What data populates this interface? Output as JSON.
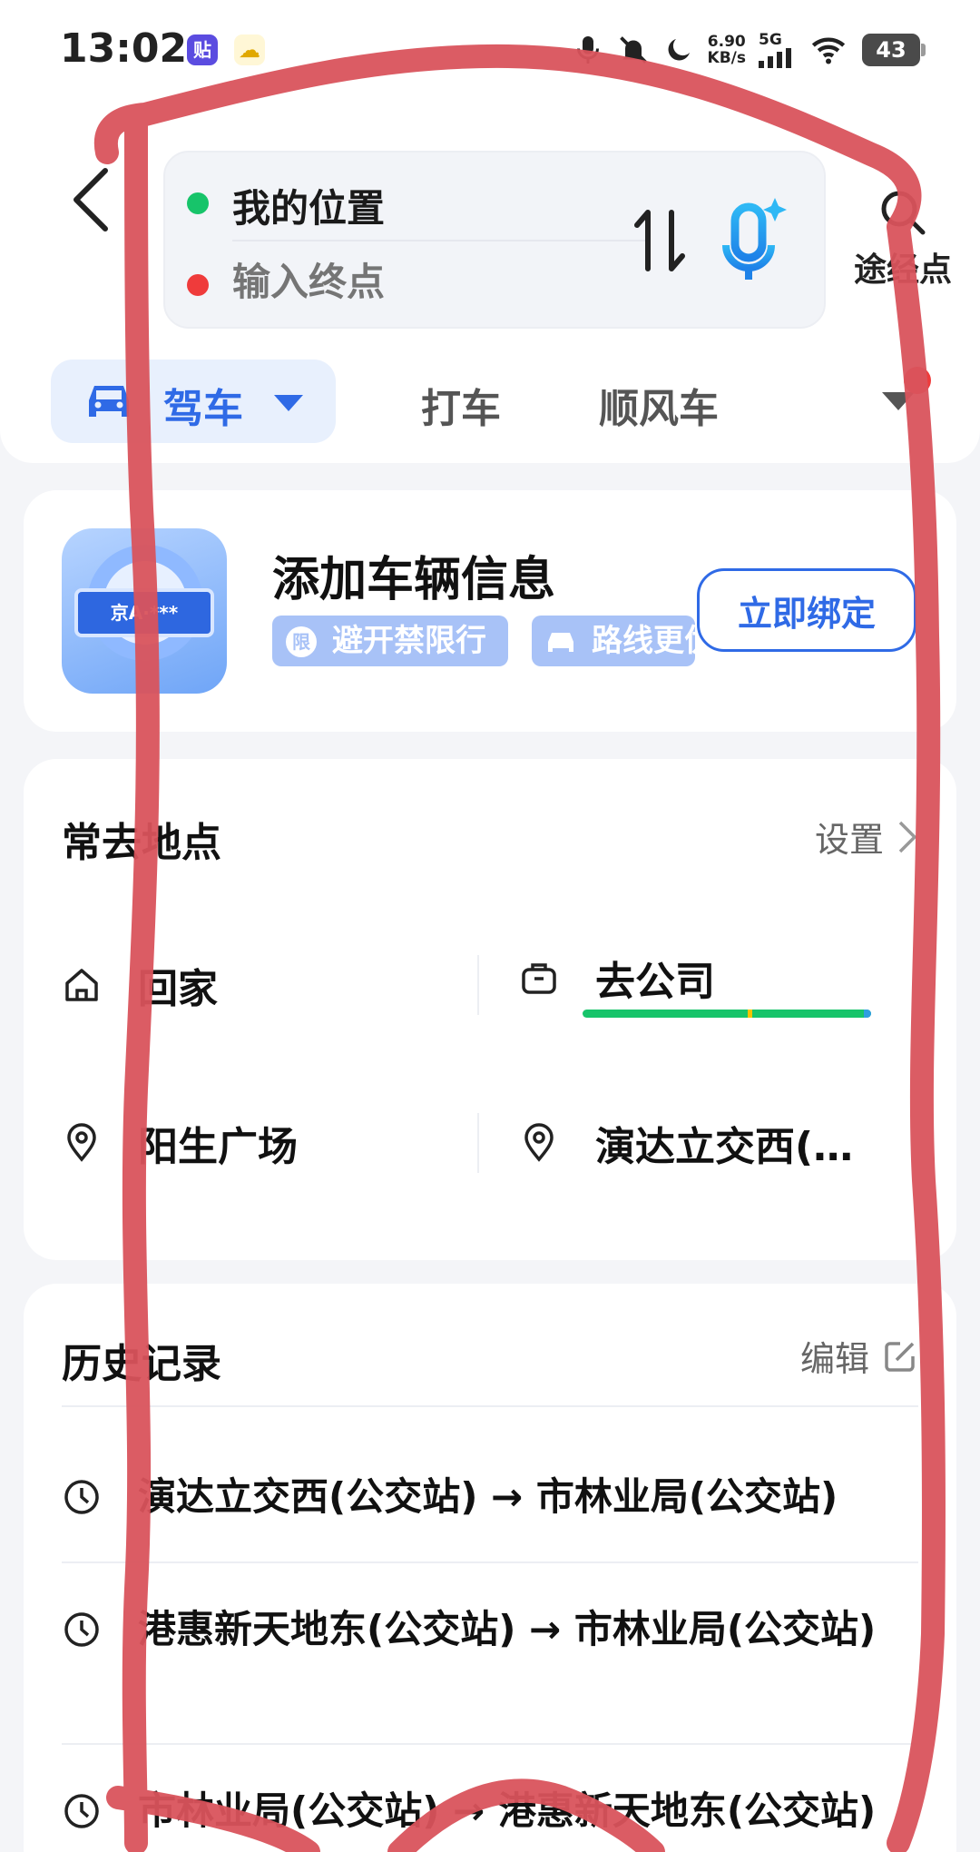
{
  "status_bar": {
    "time": "13:02",
    "app_badge_1": "贴",
    "app_badge_2": "☁",
    "net_speed_value": "6.90",
    "net_speed_unit": "KB/s",
    "network": "5G",
    "battery": "43"
  },
  "header": {
    "from_label": "我的位置",
    "to_placeholder": "输入终点",
    "waypoint_label": "途经点",
    "tabs": [
      {
        "label": "驾车",
        "active": true
      },
      {
        "label": "打车"
      },
      {
        "label": "顺风车"
      }
    ]
  },
  "vehicle_card": {
    "plate_text": "京A·***",
    "title": "添加车辆信息",
    "chips": [
      "避开禁限行",
      "路线更优"
    ],
    "chip_1_icon_text": "限",
    "bind_button": "立即绑定"
  },
  "frequent_places": {
    "title": "常去地点",
    "action": "设置",
    "places": [
      {
        "label": "回家",
        "icon": "home-icon"
      },
      {
        "label": "去公司",
        "icon": "briefcase-icon"
      },
      {
        "label": "阳生广场",
        "icon": "location-pin-icon"
      },
      {
        "label": "演达立交西(…",
        "icon": "location-pin-icon"
      }
    ]
  },
  "history": {
    "title": "历史记录",
    "action": "编辑",
    "items": [
      "演达立交西(公交站) → 市林业局(公交站)",
      "港惠新天地东(公交站) → 市林业局(公交站)",
      "市林业局(公交站) → 港惠新天地东(公交站)"
    ]
  },
  "colors": {
    "accent": "#2f6ae6",
    "origin_dot": "#17c46a",
    "destination_dot": "#ef3b3b",
    "annotation": "#d9535c"
  }
}
